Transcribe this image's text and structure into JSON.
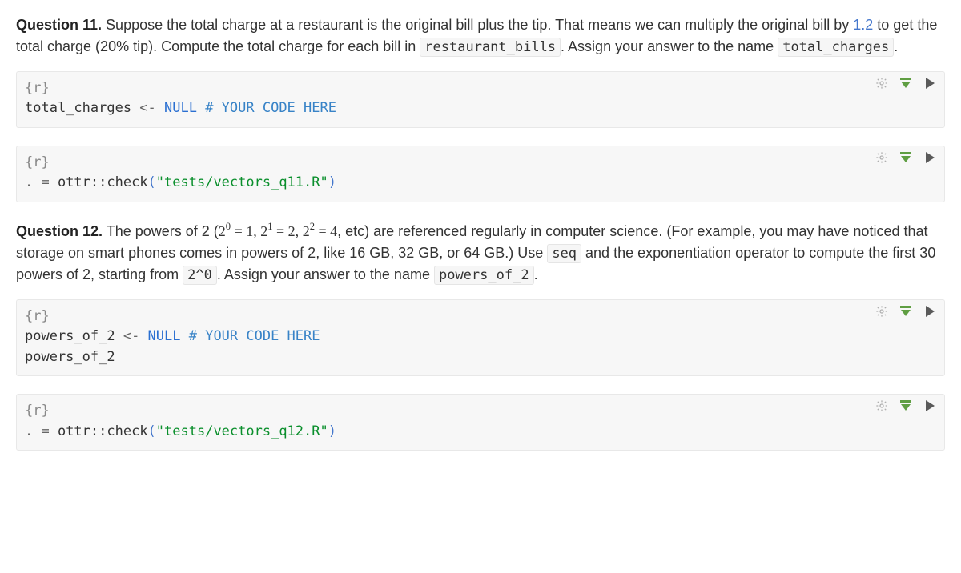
{
  "q11": {
    "title": "Question 11.",
    "text_before_num": " Suppose the total charge at a restaurant is the original bill plus the tip. That means we can multiply the original bill by ",
    "number": "1.2",
    "text_after_num": " to get the total charge (20% tip). Compute the total charge for each bill in ",
    "code1": "restaurant_bills",
    "text_after_code1": ". Assign your answer to the name ",
    "code2": "total_charges",
    "text_after_code2": "."
  },
  "cell1": {
    "header": "{r}",
    "var": "total_charges",
    "op": " <- ",
    "kw": "NULL",
    "cmt": " # YOUR CODE HERE"
  },
  "cell2": {
    "header": "{r}",
    "dot": ". = ",
    "call": "ottr::check",
    "paren_open": "(",
    "str": "\"tests/vectors_q11.R\"",
    "paren_close": ")"
  },
  "q12": {
    "title": "Question 12.",
    "text1": " The powers of 2 (",
    "pow0_base": "2",
    "pow0_exp": "0",
    "pow0_eq": " = 1, ",
    "pow1_base": "2",
    "pow1_exp": "1",
    "pow1_eq": " = 2, ",
    "pow2_base": "2",
    "pow2_exp": "2",
    "pow2_eq": " = 4",
    "text2": ", etc) are referenced regularly in computer science. (For example, you may have noticed that storage on smart phones comes in powers of 2, like 16 GB, 32 GB, or 64 GB.) Use ",
    "code_seq": "seq",
    "text3": " and the exponentiation operator to compute the first 30 powers of 2, starting from ",
    "code_start": "2^0",
    "text4": ". Assign your answer to the name ",
    "code_var": "powers_of_2",
    "text5": "."
  },
  "cell3": {
    "header": "{r}",
    "var": "powers_of_2",
    "op": " <- ",
    "kw": "NULL",
    "cmt": " # YOUR CODE HERE",
    "line2": "powers_of_2"
  },
  "cell4": {
    "header": "{r}",
    "dot": ". = ",
    "call": "ottr::check",
    "paren_open": "(",
    "str": "\"tests/vectors_q12.R\"",
    "paren_close": ")"
  },
  "icons": {
    "gear": "chunk-options",
    "run_above": "run-above",
    "run": "run-chunk"
  }
}
